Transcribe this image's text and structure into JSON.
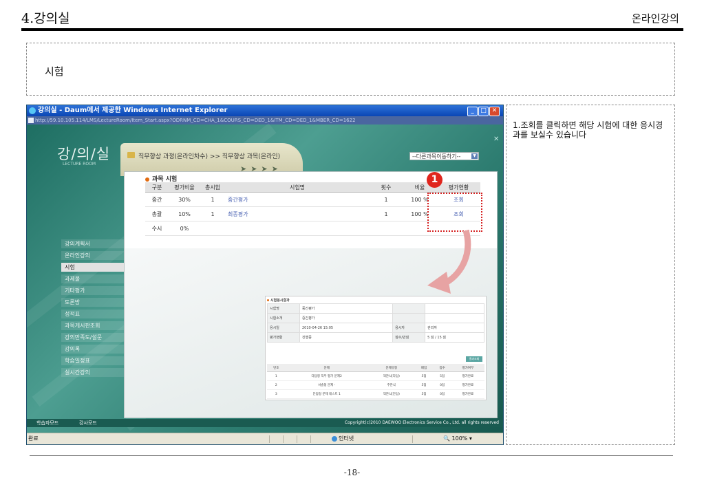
{
  "header": {
    "chapter": "4.강의실",
    "section": "온라인강의"
  },
  "title_box": {
    "label": "시험"
  },
  "note": {
    "text": "1.조회를 클릭하면 해당 시험에 대한 응시경과를 보실수 있습니다"
  },
  "footer": {
    "page": "-18-"
  },
  "screenshot": {
    "window_title": "강의실 - Daum에서 제공한 Windows Internet Explorer",
    "url": "http://59.10.105.114/LMS/LectureRoom/Item_Start.aspx?ODRNM_CD=CHA_1&COURS_CD=DED_1&ITM_CD=DED_1&MBER_CD=1622",
    "logo": "강/의/실",
    "logo_sub": "LECTURE ROOM",
    "breadcrumb": "직무향상 과정(온라인차수) >> 직무향상 과목(온라인)",
    "goto_select": "--다른과목이동하기--",
    "menu": [
      "강의계획서",
      "온라인강의",
      "시험",
      "과제물",
      "기타평가",
      "토론방",
      "성적표",
      "과목게시판조회",
      "강의만족도/설문",
      "강의록",
      "학습일정표",
      "실시간강의"
    ],
    "menu_active_index": 2,
    "section_title": "과목 시험",
    "exam_table": {
      "headers": [
        "구분",
        "평가비율",
        "총시험",
        "시험명",
        "횟수",
        "비율",
        "평가현황"
      ],
      "rows": [
        [
          "중간",
          "30%",
          "1",
          "중간평가",
          "1",
          "100 %",
          "조회"
        ],
        [
          "총괄",
          "10%",
          "1",
          "최종평가",
          "1",
          "100 %",
          "조회"
        ],
        [
          "수시",
          "0%",
          "",
          "",
          "",
          "",
          ""
        ]
      ]
    },
    "badge": "1",
    "result": {
      "title": "시험응시결과",
      "fields": [
        [
          "시험명",
          "중간평가",
          "",
          ""
        ],
        [
          "시험소개",
          "중간평가",
          "",
          ""
        ],
        [
          "응시일",
          "2010-04-26 15:05",
          "응시자",
          "관리자"
        ],
        [
          "평가현황",
          "진행중",
          "점수/만점",
          "5 점 / 15 점"
        ]
      ],
      "button": "결과조회",
      "headers": [
        "번호",
        "문제",
        "문제유형",
        "배점",
        "점수",
        "평가여부"
      ],
      "rows": [
        [
          "1",
          "다답형 직무 평가 문제2",
          "객관식(다답)",
          "5점",
          "5점",
          "평가완료"
        ],
        [
          "2",
          "서술형 문제 -",
          "주관식",
          "5점",
          "0점",
          "평가완료"
        ],
        [
          "3",
          "단답형 문제 테스트 1",
          "객관식(단답)",
          "5점",
          "0점",
          "평가완료"
        ]
      ]
    },
    "bottom_left": [
      "학습자모드",
      "강사모드"
    ],
    "copyright": "Copyright(c)2010 DAEWOO Electronics Service Co., Ltd. all rights reserved",
    "status_left": "완료",
    "status_zone": "인터넷",
    "zoom": "100%"
  }
}
